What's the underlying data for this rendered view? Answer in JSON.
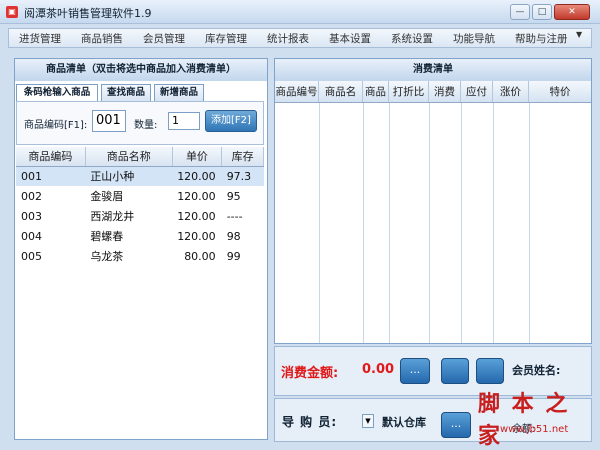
{
  "window": {
    "title": "阅潭茶叶销售管理软件1.9",
    "icon": "app-icon"
  },
  "menu": [
    "进货管理",
    "商品销售",
    "会员管理",
    "库存管理",
    "统计报表",
    "基本设置",
    "系统设置",
    "功能导航",
    "帮助与注册"
  ],
  "left": {
    "header": "商品清单（双击将选中商品加入消费清单）",
    "tabs": [
      "条码枪输入商品",
      "查找商品",
      "新增商品"
    ],
    "code_label": "商品编码[F1]:",
    "code_value": "001",
    "qty_label": "数量:",
    "qty_value": "1",
    "add_button": "添加[F2]",
    "table_headers": [
      "商品编码",
      "商品名称",
      "单价",
      "库存"
    ],
    "rows": [
      {
        "code": "001",
        "name": "正山小种",
        "price": "120.00",
        "stock": "97.3"
      },
      {
        "code": "002",
        "name": "金骏眉",
        "price": "120.00",
        "stock": "95"
      },
      {
        "code": "003",
        "name": "西湖龙井",
        "price": "120.00",
        "stock": "----"
      },
      {
        "code": "004",
        "name": "碧螺春",
        "price": "120.00",
        "stock": "98"
      },
      {
        "code": "005",
        "name": "乌龙茶",
        "price": "80.00",
        "stock": "99"
      }
    ]
  },
  "right": {
    "header": "消费清单",
    "columns": [
      "商品编号",
      "商品名",
      "商品",
      "打折比",
      "消费",
      "应付",
      "涨价",
      "特价"
    ]
  },
  "bottom": {
    "amount_label": "消费金额:",
    "amount_value": "0.00",
    "btn_dots": "...",
    "member_label": "会员姓名:",
    "guide_label": "导 购 员:",
    "guide_value": "默认仓库",
    "balance_label": "余额:"
  },
  "watermark": {
    "text": "脚 本 之 家",
    "url": "www.jb51.net"
  },
  "colors": {
    "accent": "#2f75b5",
    "amount": "#e01818",
    "panel_border": "#7ea4cc"
  }
}
